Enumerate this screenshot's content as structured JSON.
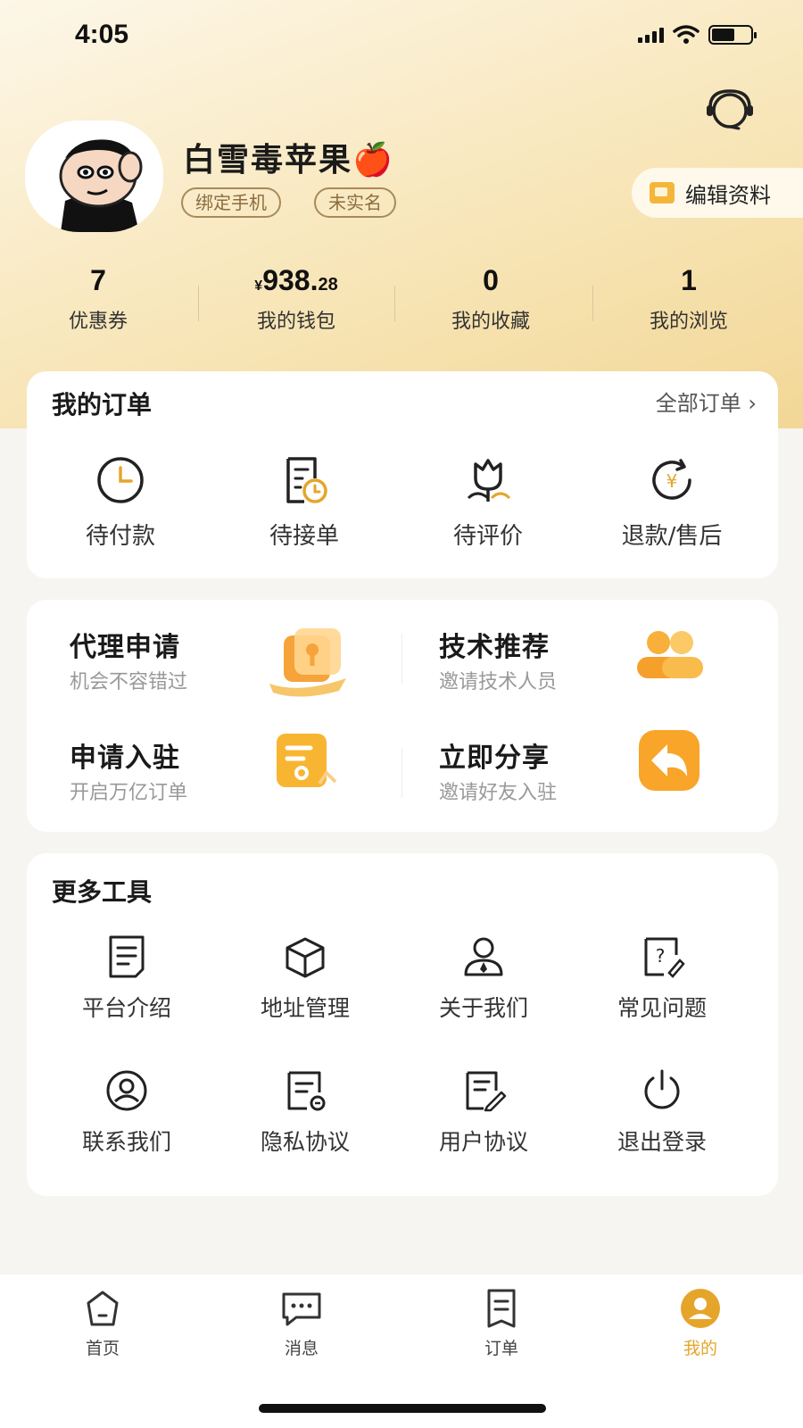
{
  "status_bar": {
    "time": "4:05"
  },
  "profile": {
    "username": "白雪毒苹果🍎",
    "tags": [
      "绑定手机",
      "未实名"
    ],
    "edit_label": "编辑资料"
  },
  "stats": [
    {
      "value": "7",
      "label": "优惠券"
    },
    {
      "currency": "¥",
      "integer": "938.",
      "decimal": "28",
      "label": "我的钱包"
    },
    {
      "value": "0",
      "label": "我的收藏"
    },
    {
      "value": "1",
      "label": "我的浏览"
    }
  ],
  "orders": {
    "title": "我的订单",
    "all_link": "全部订单 ›",
    "items": [
      {
        "label": "待付款",
        "icon": "clock-icon"
      },
      {
        "label": "待接单",
        "icon": "receipt-clock-icon"
      },
      {
        "label": "待评价",
        "icon": "flower-icon"
      },
      {
        "label": "退款/售后",
        "icon": "refund-icon"
      }
    ]
  },
  "promos": [
    {
      "title": "代理申请",
      "subtitle": "机会不容错过",
      "icon": "agent-icon"
    },
    {
      "title": "技术推荐",
      "subtitle": "邀请技术人员",
      "icon": "people-icon"
    },
    {
      "title": "申请入驻",
      "subtitle": "开启万亿订单",
      "icon": "document-icon"
    },
    {
      "title": "立即分享",
      "subtitle": "邀请好友入驻",
      "icon": "share-icon"
    }
  ],
  "tools": {
    "title": "更多工具",
    "items": [
      {
        "label": "平台介绍",
        "icon": "document-icon"
      },
      {
        "label": "地址管理",
        "icon": "box-icon"
      },
      {
        "label": "关于我们",
        "icon": "person-icon"
      },
      {
        "label": "常见问题",
        "icon": "question-icon"
      },
      {
        "label": "联系我们",
        "icon": "contact-icon"
      },
      {
        "label": "隐私协议",
        "icon": "privacy-icon"
      },
      {
        "label": "用户协议",
        "icon": "agreement-icon"
      },
      {
        "label": "退出登录",
        "icon": "power-icon"
      }
    ]
  },
  "tabbar": {
    "items": [
      {
        "label": "首页",
        "icon": "home-icon"
      },
      {
        "label": "消息",
        "icon": "message-icon"
      },
      {
        "label": "订单",
        "icon": "order-icon"
      },
      {
        "label": "我的",
        "icon": "profile-icon",
        "active": true
      }
    ]
  },
  "colors": {
    "accent": "#e5a52b",
    "hero": "#f8e6b9"
  }
}
